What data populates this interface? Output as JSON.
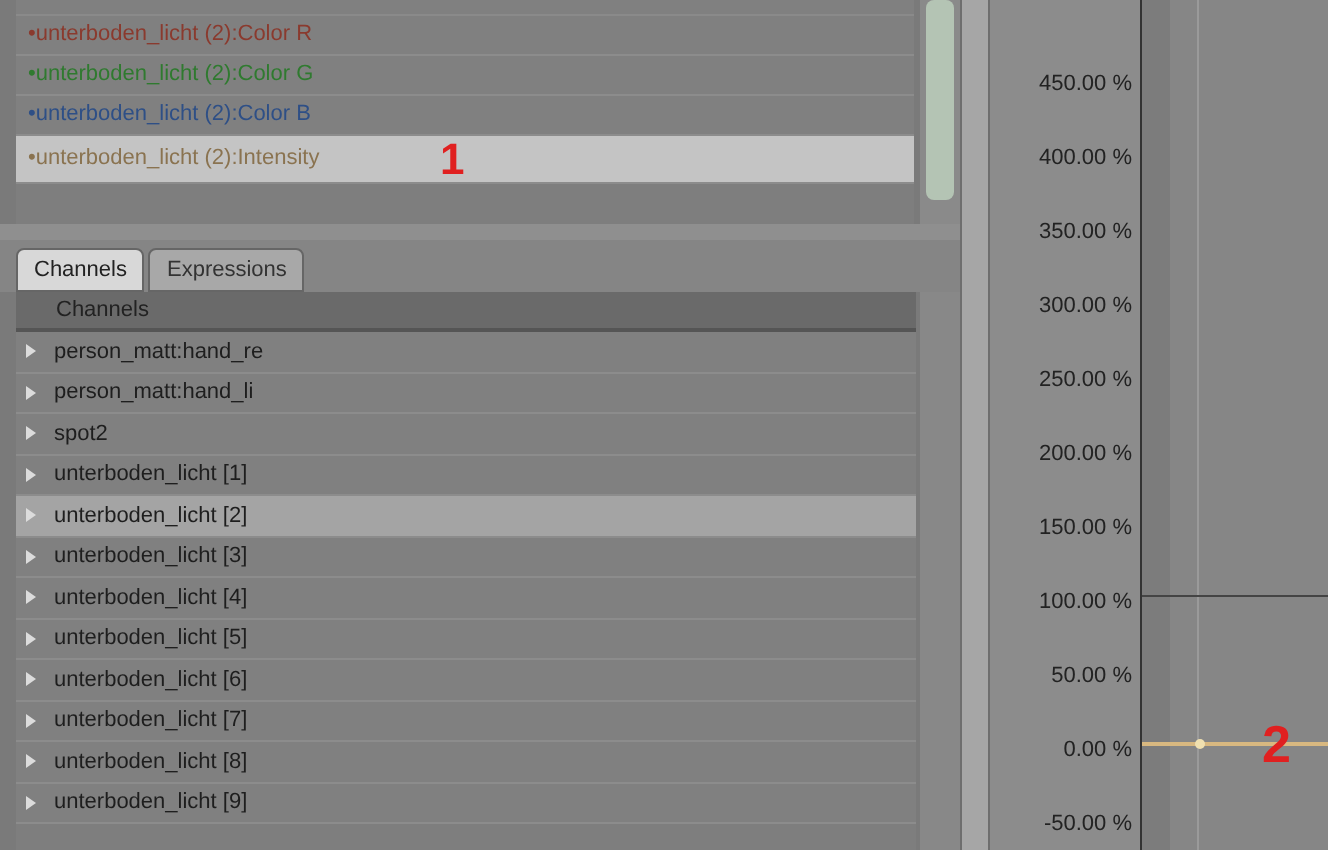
{
  "curve_list": {
    "items": [
      {
        "label": "•unterboden_licht (2):Color R",
        "color": "#8a3a2e",
        "selected": false
      },
      {
        "label": "•unterboden_licht (2):Color G",
        "color": "#2f7a2f",
        "selected": false
      },
      {
        "label": "•unterboden_licht (2):Color B",
        "color": "#2e4f86",
        "selected": false
      },
      {
        "label": "•unterboden_licht (2):Intensity",
        "color": "#8a7350",
        "selected": true
      }
    ]
  },
  "annotations": [
    {
      "text": "1"
    },
    {
      "text": "2"
    }
  ],
  "tabs": [
    {
      "label": "Channels",
      "selected": true
    },
    {
      "label": "Expressions",
      "selected": false
    }
  ],
  "channels": {
    "header": "Channels",
    "items": [
      {
        "label": "person_matt:hand_re",
        "selected": false
      },
      {
        "label": "person_matt:hand_li",
        "selected": false
      },
      {
        "label": "spot2",
        "selected": false
      },
      {
        "label": "unterboden_licht [1]",
        "selected": false
      },
      {
        "label": "unterboden_licht [2]",
        "selected": true
      },
      {
        "label": "unterboden_licht [3]",
        "selected": false
      },
      {
        "label": "unterboden_licht [4]",
        "selected": false
      },
      {
        "label": "unterboden_licht [5]",
        "selected": false
      },
      {
        "label": "unterboden_licht [6]",
        "selected": false
      },
      {
        "label": "unterboden_licht [7]",
        "selected": false
      },
      {
        "label": "unterboden_licht [8]",
        "selected": false
      },
      {
        "label": "unterboden_licht [9]",
        "selected": false
      }
    ]
  },
  "graph": {
    "y_axis_labels": [
      "450.00 %",
      "400.00 %",
      "350.00 %",
      "300.00 %",
      "250.00 %",
      "200.00 %",
      "150.00 %",
      "100.00 %",
      "50.00 %",
      "0.00 %",
      "-50.00 %"
    ]
  }
}
